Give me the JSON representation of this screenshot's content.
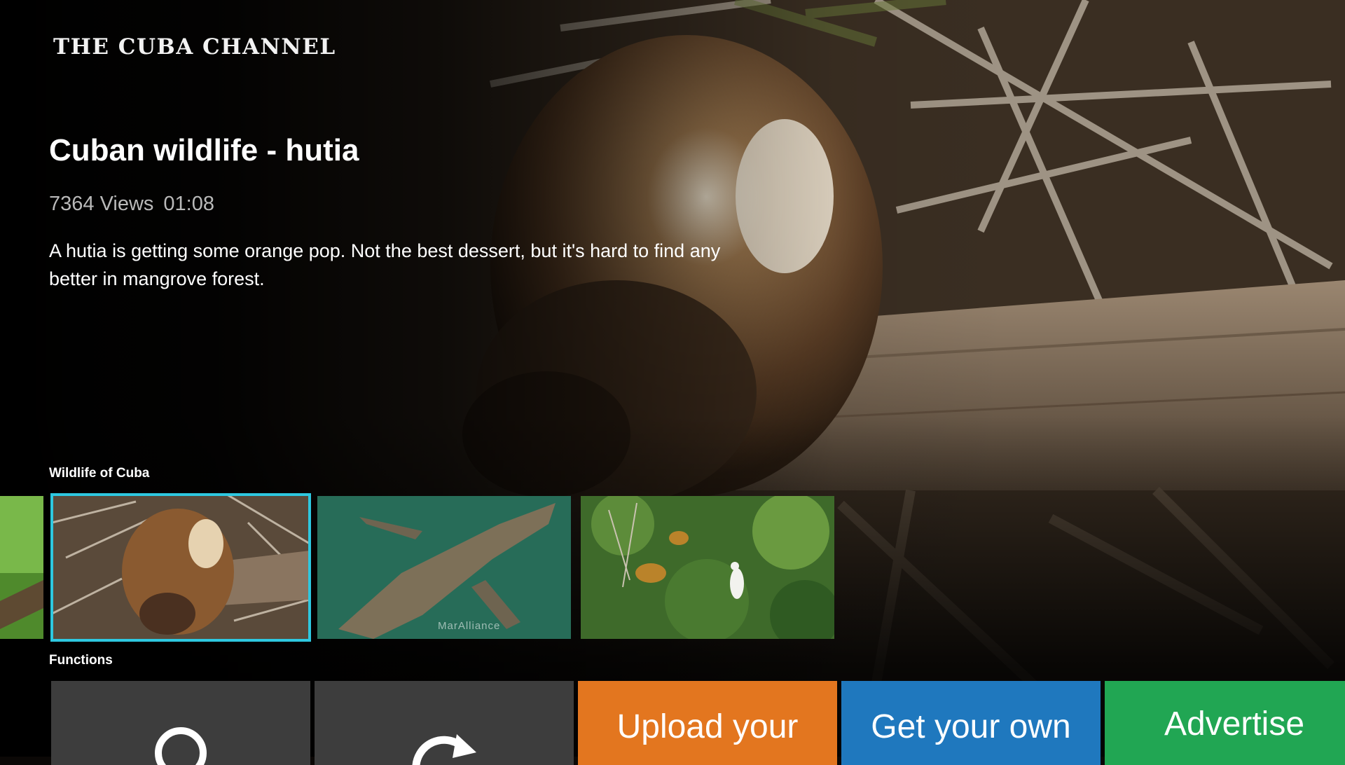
{
  "app": {
    "logo": "THE CUBA CHANNEL"
  },
  "featured": {
    "title": "Cuban wildlife - hutia",
    "views": "7364 Views",
    "duration": "01:08",
    "description": "A hutia is getting some orange pop. Not the best dessert, but it's hard to find any better in mangrove forest."
  },
  "rows": {
    "wildlife": {
      "label": "Wildlife of Cuba",
      "items": [
        {
          "subject": "partial-green-thumbnail"
        },
        {
          "subject": "hutia",
          "focused": true
        },
        {
          "subject": "crocodile",
          "watermark": "MarAlliance"
        },
        {
          "subject": "egret-in-trees"
        }
      ]
    },
    "functions": {
      "label": "Functions",
      "tiles": [
        {
          "icon": "search-icon",
          "color": "#3d3d3d"
        },
        {
          "icon": "refresh-icon",
          "color": "#3d3d3d"
        },
        {
          "label": "Upload your",
          "color": "#e3761f"
        },
        {
          "label": "Get your own",
          "color": "#1f78be"
        },
        {
          "label": "Advertise",
          "color": "#21a653"
        }
      ]
    }
  },
  "colors": {
    "focus_outline": "#2ec8e0"
  }
}
